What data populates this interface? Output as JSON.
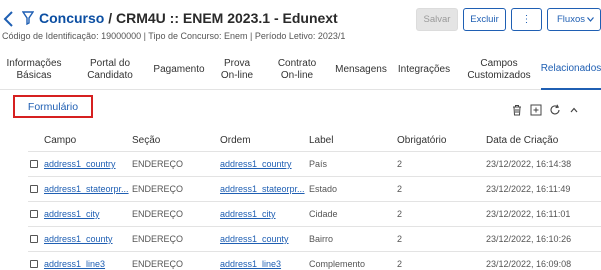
{
  "header": {
    "entity": "Concurso",
    "path": "/ CRM4U :: ENEM 2023.1 - Edunext",
    "subtitle": "Código de Identificação: 19000000 | Tipo de Concurso: Enem | Período Letivo: 2023/1"
  },
  "toolbar": {
    "save_label": "Salvar",
    "delete_label": "Excluir",
    "more_label": "⋮",
    "flows_label": "Fluxos"
  },
  "tabs": [
    {
      "label": "Informações\nBásicas"
    },
    {
      "label": "Portal do\nCandidato"
    },
    {
      "label": "Pagamento"
    },
    {
      "label": "Prova\nOn-line"
    },
    {
      "label": "Contrato\nOn-line"
    },
    {
      "label": "Mensagens"
    },
    {
      "label": "Integrações"
    },
    {
      "label": "Campos\nCustomizados"
    },
    {
      "label": "Relacionados",
      "active": true
    }
  ],
  "section": {
    "title": "Formulário"
  },
  "table": {
    "columns": [
      "Campo",
      "Seção",
      "Ordem",
      "Label",
      "Obrigatório",
      "Data de Criação"
    ],
    "rows": [
      {
        "campo": "address1_country",
        "secao": "ENDEREÇO",
        "ordem": "address1_country",
        "label": "País",
        "obrigatorio": "2",
        "data": "23/12/2022, 16:14:38"
      },
      {
        "campo": "address1_stateorpr...",
        "secao": "ENDEREÇO",
        "ordem": "address1_stateorpr...",
        "label": "Estado",
        "obrigatorio": "2",
        "data": "23/12/2022, 16:11:49"
      },
      {
        "campo": "address1_city",
        "secao": "ENDEREÇO",
        "ordem": "address1_city",
        "label": "Cidade",
        "obrigatorio": "2",
        "data": "23/12/2022, 16:11:01"
      },
      {
        "campo": "address1_county",
        "secao": "ENDEREÇO",
        "ordem": "address1_county",
        "label": "Bairro",
        "obrigatorio": "2",
        "data": "23/12/2022, 16:10:26"
      },
      {
        "campo": "address1_line3",
        "secao": "ENDEREÇO",
        "ordem": "address1_line3",
        "label": "Complemento",
        "obrigatorio": "2",
        "data": "23/12/2022, 16:09:08"
      }
    ]
  },
  "colors": {
    "accent": "#1f5fb3",
    "highlight_border": "#d62020"
  }
}
